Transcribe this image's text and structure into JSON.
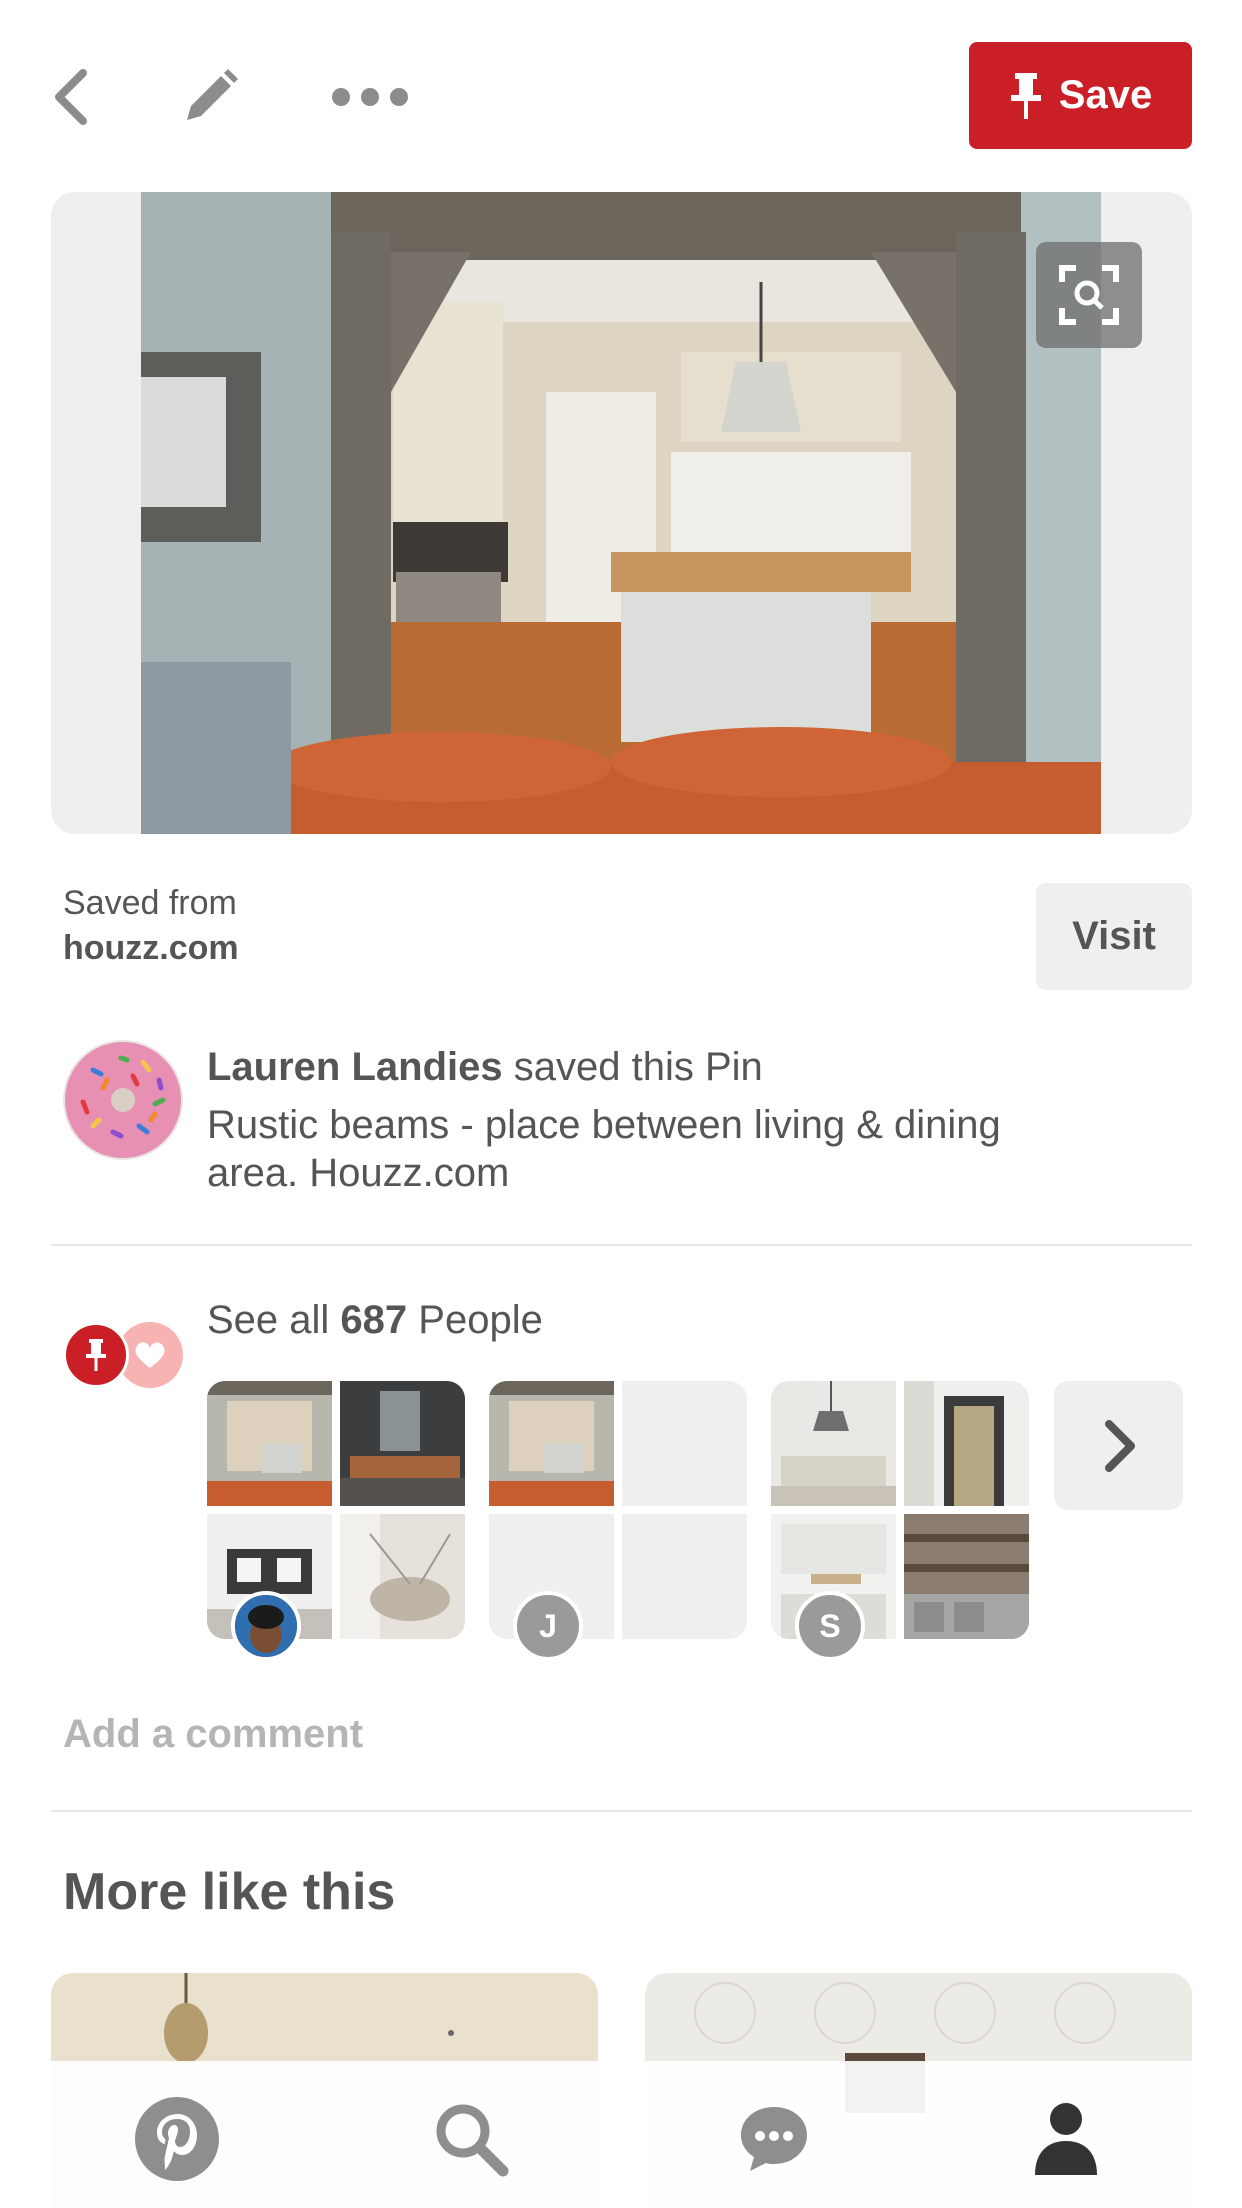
{
  "header": {
    "back_icon": "chevron-left-icon",
    "edit_icon": "pencil-icon",
    "more_icon": "ellipsis-icon",
    "save_label": "Save",
    "save_icon": "pushpin-icon",
    "accent_color": "#cb1f27"
  },
  "pin": {
    "image_subject": "kitchen-through-rustic-beams-photo",
    "lens_icon": "visual-search-icon"
  },
  "source": {
    "label": "Saved from",
    "domain": "houzz.com",
    "visit_label": "Visit"
  },
  "saver": {
    "name": "Lauren Landies",
    "action": " saved this Pin",
    "description": "Rustic beams - place between living & dining area. Houzz.com"
  },
  "activity": {
    "prefix": "See all ",
    "count": "687",
    "suffix": " People",
    "boards": [
      {
        "avatar_initial": "",
        "avatar_type": "photo"
      },
      {
        "avatar_initial": "J",
        "avatar_type": "initial"
      },
      {
        "avatar_initial": "S",
        "avatar_type": "initial"
      }
    ],
    "next_icon": "chevron-right-icon"
  },
  "comment": {
    "placeholder": "Add a comment"
  },
  "more": {
    "title": "More like this"
  },
  "tabbar": {
    "items": [
      "pinterest-logo-icon",
      "search-icon",
      "chat-bubble-icon",
      "profile-icon"
    ]
  }
}
